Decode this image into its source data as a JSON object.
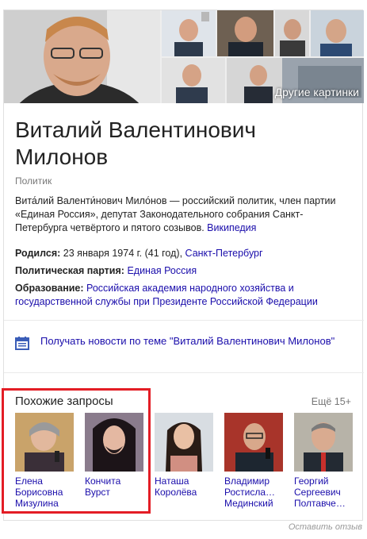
{
  "photos": {
    "more_label": "Другие картинки"
  },
  "person": {
    "name_line1": "Виталий Валентинович",
    "name_line2": "Милонов",
    "category": "Политик",
    "description": "Вита́лий Валенти́нович Мило́нов — российский политик, член партии «Единая Россия», депутат Законодательного собрания Санкт-Петербурга четвёртого и пятого созывов.",
    "source_link": "Википедия"
  },
  "facts": {
    "born_label": "Родился:",
    "born_value": "23 января 1974 г. (41 год),",
    "born_place": "Санкт-Петербург",
    "party_label": "Политическая партия:",
    "party_value": "Единая Россия",
    "education_label": "Образование:",
    "education_value": "Российская академия народного хозяйства и государственной службы при Президенте Российской Федерации"
  },
  "news": {
    "label": "Получать новости по теме \"Виталий Валентинович Милонов\""
  },
  "similar": {
    "heading": "Похожие запросы",
    "more": "Ещё 15+",
    "items": [
      {
        "name": "Елена Борисовна Мизулина"
      },
      {
        "name": "Кончита Вурст"
      },
      {
        "name": "Наташа Королёва"
      },
      {
        "name": "Владимир Ростисла… Мединский"
      },
      {
        "name": "Георгий Сергеевич Полтавче…"
      }
    ]
  },
  "footer": {
    "feedback": "Оставить отзыв"
  },
  "colors": {
    "link": "#1a0dab",
    "highlight": "#e31d25"
  }
}
